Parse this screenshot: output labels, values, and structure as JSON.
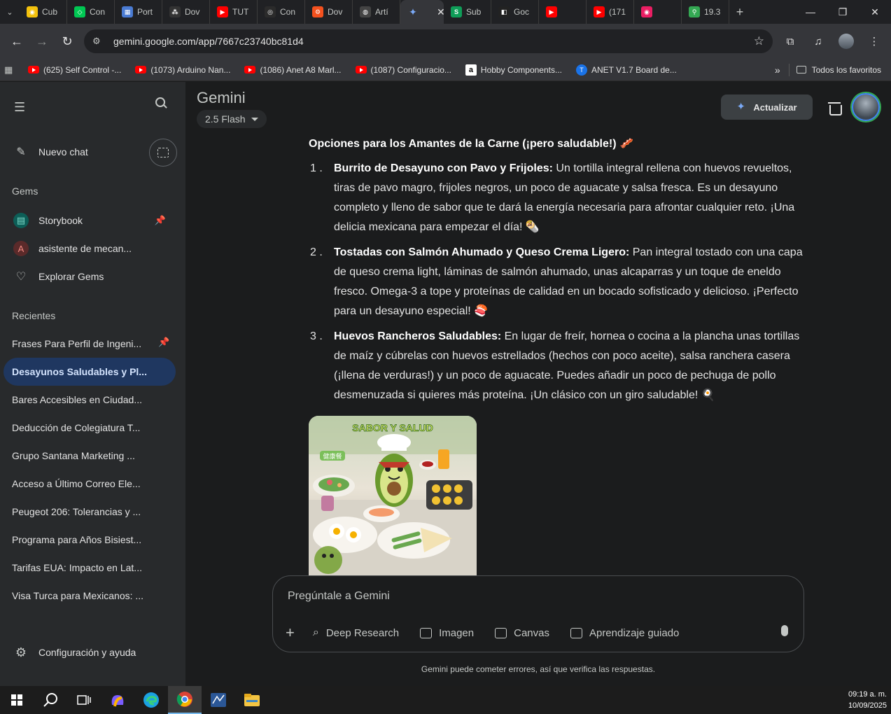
{
  "browser": {
    "tabs": [
      {
        "label": "Cub",
        "fav_color": "#f4c20d",
        "fav_glyph": "◉"
      },
      {
        "label": "Con",
        "fav_color": "#00c853",
        "fav_glyph": "◇"
      },
      {
        "label": "Port",
        "fav_color": "#4a7bd3",
        "fav_glyph": "▦"
      },
      {
        "label": "Dov",
        "fav_color": "#333333",
        "fav_glyph": "⁂"
      },
      {
        "label": "TUT",
        "fav_color": "#ff0000",
        "fav_glyph": "▶"
      },
      {
        "label": "Con",
        "fav_color": "#2b2b2b",
        "fav_glyph": "◎"
      },
      {
        "label": "Dov",
        "fav_color": "#f4511e",
        "fav_glyph": "⚙"
      },
      {
        "label": "Artí",
        "fav_color": "#444444",
        "fav_glyph": "◍"
      },
      {
        "label": "Sub",
        "fav_color": "#0f9d58",
        "fav_glyph": "S"
      },
      {
        "label": "Goc",
        "fav_color": "#222222",
        "fav_glyph": "◧"
      },
      {
        "label": "",
        "fav_color": "#ff0000",
        "fav_glyph": "▶"
      },
      {
        "label": "(171",
        "fav_color": "#ff0000",
        "fav_glyph": "▶"
      },
      {
        "label": "",
        "fav_color": "#e91e63",
        "fav_glyph": "◉"
      },
      {
        "label": "19.3",
        "fav_color": "#34a853",
        "fav_glyph": "⚲"
      }
    ],
    "url": "gemini.google.com/app/7667c23740bc81d4",
    "bookmarks": [
      {
        "label": "(625) Self Control -...",
        "icon": "youtube-icon"
      },
      {
        "label": "(1073) Arduino Nan...",
        "icon": "youtube-icon"
      },
      {
        "label": "(1086) Anet A8 Marl...",
        "icon": "youtube-icon"
      },
      {
        "label": "(1087) Configuracio...",
        "icon": "youtube-icon"
      },
      {
        "label": "Hobby Components...",
        "icon": "amazon-icon"
      },
      {
        "label": "ANET V1.7 Board de...",
        "icon": "t-icon"
      }
    ],
    "all_bookmarks": "Todos los favoritos"
  },
  "sidebar": {
    "new_chat": "Nuevo chat",
    "gems_heading": "Gems",
    "gems": [
      {
        "label": "Storybook",
        "pinned": true
      },
      {
        "label": "asistente de mecan...",
        "letter": "A",
        "pinned": false
      }
    ],
    "explore_gems": "Explorar Gems",
    "recents_heading": "Recientes",
    "recents": [
      "Frases Para Perfil de Ingeni...",
      "Desayunos Saludables y Pl...",
      "Bares Accesibles en Ciudad...",
      "Deducción de Colegiatura T...",
      "Grupo Santana Marketing ...",
      "Acceso a Último Correo Ele...",
      "Peugeot 206: Tolerancias y ...",
      "Programa para Años Bisiest...",
      "Tarifas EUA: Impacto en Lat...",
      "Visa Turca para Mexicanos: ..."
    ],
    "settings": "Configuración y ayuda"
  },
  "header": {
    "app_title": "Gemini",
    "model": "2.5 Flash",
    "upgrade": "Actualizar"
  },
  "response": {
    "section_title": "Opciones para los Amantes de la Carne (¡pero saludable!) 🥓",
    "items": [
      {
        "num": "1 .",
        "title": "Burrito de Desayuno con Pavo y Frijoles:",
        "text": " Un tortilla integral rellena con huevos revueltos, tiras de pavo magro, frijoles negros, un poco de aguacate y salsa fresca. Es un desayuno completo y lleno de sabor que te dará la energía necesaria para afrontar cualquier reto. ¡Una delicia mexicana para empezar el día! 🌯"
      },
      {
        "num": "2 .",
        "title": "Tostadas con Salmón Ahumado y Queso Crema Ligero:",
        "text": " Pan integral tostado con una capa de queso crema light, láminas de salmón ahumado, unas alcaparras y un toque de eneldo fresco. Omega-3 a tope y proteínas de calidad en un bocado sofisticado y delicioso. ¡Perfecto para un desayuno especial! 🍣"
      },
      {
        "num": "3 .",
        "title": "Huevos Rancheros Saludables:",
        "text": " En lugar de freír, hornea o cocina a la plancha unas tortillas de maíz y cúbrelas con huevos estrellados (hechos con poco aceite), salsa ranchera casera (¡llena de verduras!) y un poco de aguacate. Puedes añadir un poco de pechuga de pollo desmenuzada si quieres más proteína. ¡Un clásico con un giro saludable! 🍳"
      }
    ],
    "image_title": "SABOR Y SALUD",
    "image_tag": "健康餐"
  },
  "composer": {
    "placeholder": "Pregúntale a Gemini",
    "tools": [
      "Deep Research",
      "Imagen",
      "Canvas",
      "Aprendizaje guiado"
    ],
    "disclaimer": "Gemini puede cometer errores, así que verifica las respuestas."
  },
  "taskbar": {
    "time": "09:19 a. m.",
    "date": "10/09/2025"
  }
}
